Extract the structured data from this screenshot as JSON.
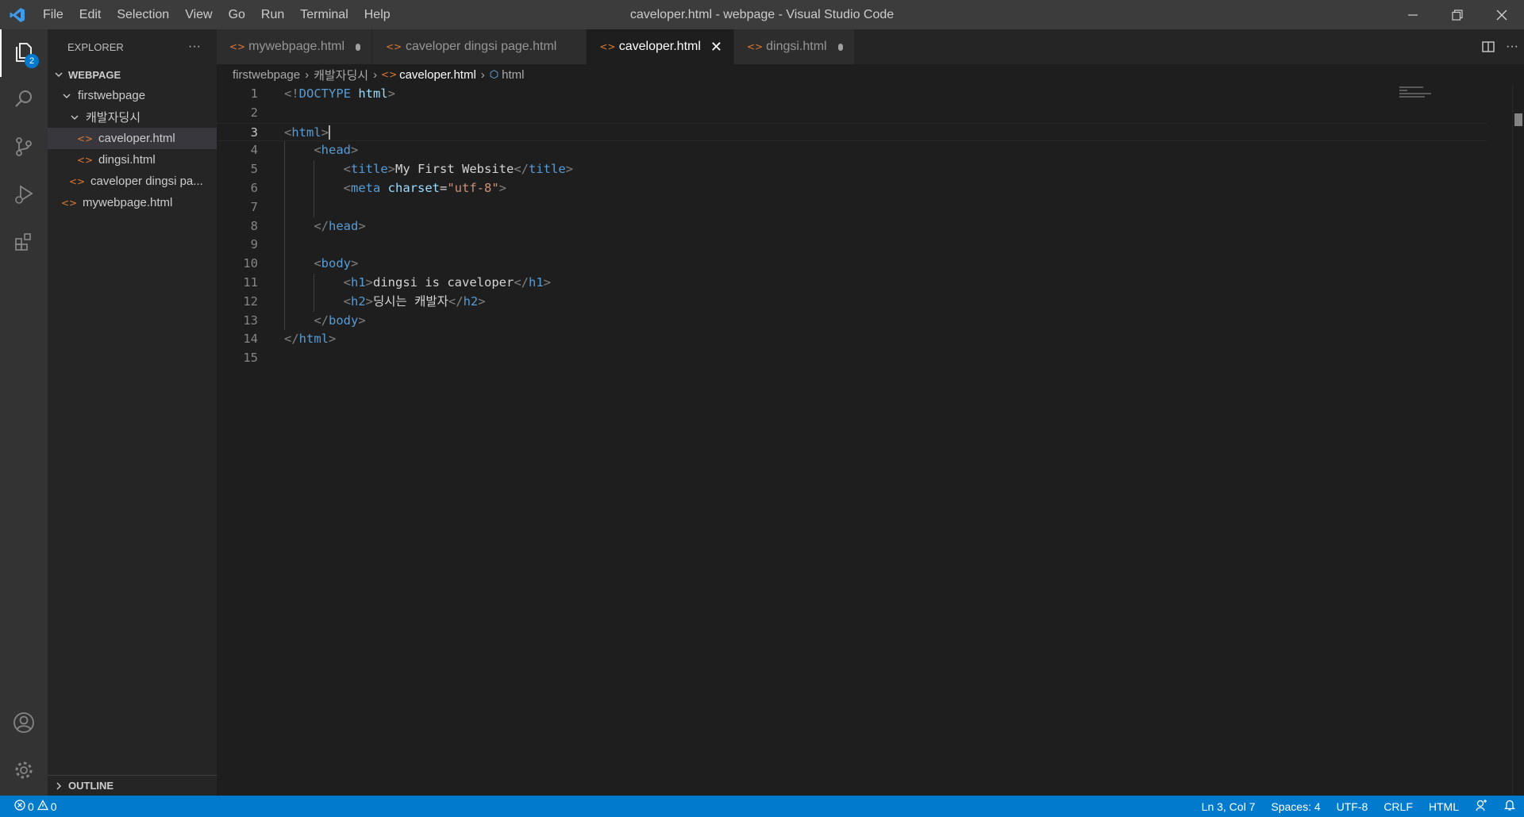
{
  "titlebar": {
    "menu": [
      "File",
      "Edit",
      "Selection",
      "View",
      "Go",
      "Run",
      "Terminal",
      "Help"
    ],
    "title": "caveloper.html - webpage - Visual Studio Code"
  },
  "activity": {
    "explorer_badge": "2"
  },
  "sidebar": {
    "header": "EXPLORER",
    "more": "···",
    "section": "WEBPAGE",
    "tree": [
      {
        "label": "firstwebpage",
        "type": "folder"
      },
      {
        "label": "캐발자딩시",
        "type": "folder"
      },
      {
        "label": "caveloper.html",
        "type": "file"
      },
      {
        "label": "dingsi.html",
        "type": "file"
      },
      {
        "label": "caveloper dingsi pa...",
        "type": "file"
      },
      {
        "label": "mywebpage.html",
        "type": "file"
      }
    ],
    "outline": "OUTLINE"
  },
  "tabs": [
    {
      "label": "mywebpage.html",
      "dirty": true,
      "active": false
    },
    {
      "label": "caveloper dingsi page.html",
      "dirty": false,
      "active": false
    },
    {
      "label": "caveloper.html",
      "dirty": false,
      "active": true
    },
    {
      "label": "dingsi.html",
      "dirty": true,
      "active": false
    }
  ],
  "breadcrumb": [
    "firstwebpage",
    "캐발자딩시",
    "caveloper.html",
    "html"
  ],
  "editor": {
    "active_line": 3,
    "lines": [
      "<!DOCTYPE html>",
      "",
      "<html>",
      "    <head>",
      "        <title>My First Website</title>",
      "        <meta charset=\"utf-8\">",
      "",
      "    </head>",
      "",
      "    <body>",
      "        <h1>dingsi is caveloper</h1>",
      "        <h2>딩시는 캐발자</h2>",
      "    </body>",
      "</html>",
      ""
    ]
  },
  "statusbar": {
    "errors": "0",
    "warnings": "0",
    "position": "Ln 3, Col 7",
    "spaces": "Spaces: 4",
    "encoding": "UTF-8",
    "eol": "CRLF",
    "language": "HTML"
  },
  "colors": {
    "accent": "#007acc",
    "tag": "#569cd6",
    "attr": "#9cdcfe",
    "string": "#ce9178",
    "file_icon": "#e37933"
  }
}
